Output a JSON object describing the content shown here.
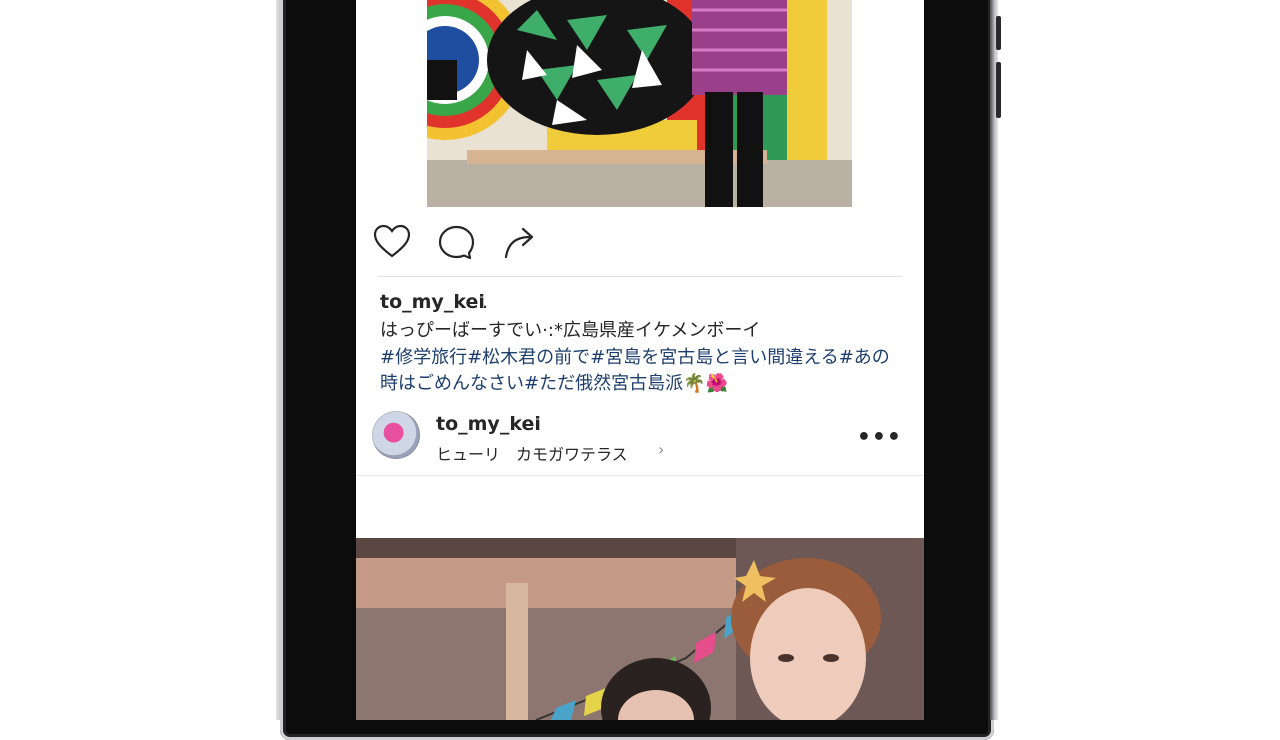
{
  "post": {
    "username": "to_my_kei",
    "username_suffix": ".",
    "caption": "はっぴーばーすでい·:*広島県産イケメンボーイ",
    "hashtags": "#修学旅行#松木君の前で#宮島を宮古島と言い間違える#あの時はごめんなさい#ただ俄然宮古島派",
    "hashtag_emoji": "🌴🌺",
    "icons": {
      "like": "heart-icon",
      "comment": "comment-icon",
      "share": "share-icon"
    }
  },
  "next_post": {
    "username": "to_my_kei",
    "location": "ヒューリ　カモガワテラス",
    "location_chevron": "›",
    "more_label": "•••"
  },
  "colors": {
    "text": "#262626",
    "hashtag": "#1e3f6e",
    "divider": "#e3e3e3",
    "frame": "#0c0c0c"
  }
}
